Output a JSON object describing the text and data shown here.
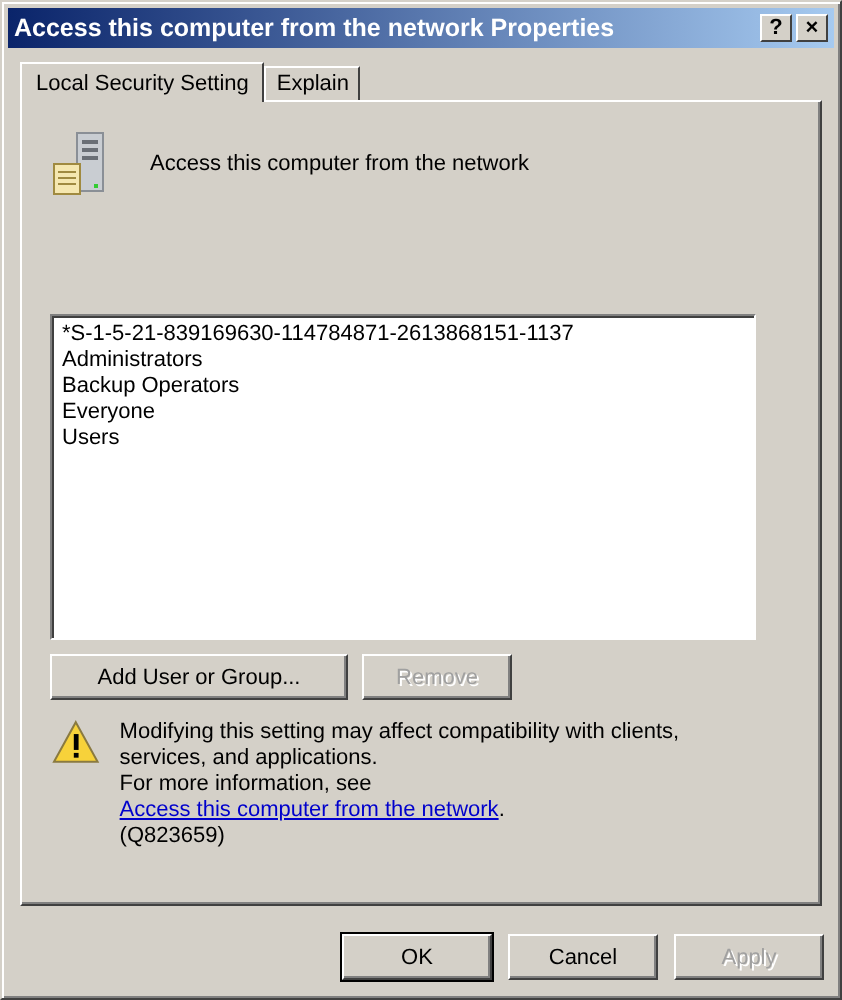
{
  "window": {
    "title": "Access this computer from the network Properties",
    "title_buttons": [
      "?",
      "×"
    ]
  },
  "tabs": [
    {
      "label": "Local Security Setting",
      "selected": true
    },
    {
      "label": "Explain",
      "selected": false
    }
  ],
  "policy": {
    "name": "Access this computer from the network"
  },
  "accounts": [
    {
      "name": "*S-1-5-21-839169630-114784871-2613868151-1137",
      "selected": false
    },
    {
      "name": "Administrators",
      "selected": false
    },
    {
      "name": "Backup Operators",
      "selected": false
    },
    {
      "name": "Everyone",
      "selected": false
    },
    {
      "name": "Users",
      "selected": false
    }
  ],
  "list_buttons": [
    {
      "label": "Add User or Group...",
      "disabled": false
    },
    {
      "label": "Remove",
      "disabled": true
    }
  ],
  "warning": {
    "text": "Modifying this setting may affect compatibility with clients, services, and applications.",
    "info_prefix": "For more information, see ",
    "link": "Access this computer from the network",
    "info_suffix": ".",
    "reference": "(Q823659)"
  },
  "buttons": [
    {
      "label": "OK",
      "disabled": false,
      "default": true
    },
    {
      "label": "Cancel",
      "disabled": false,
      "default": false
    },
    {
      "label": "Apply",
      "disabled": true,
      "default": false
    }
  ]
}
